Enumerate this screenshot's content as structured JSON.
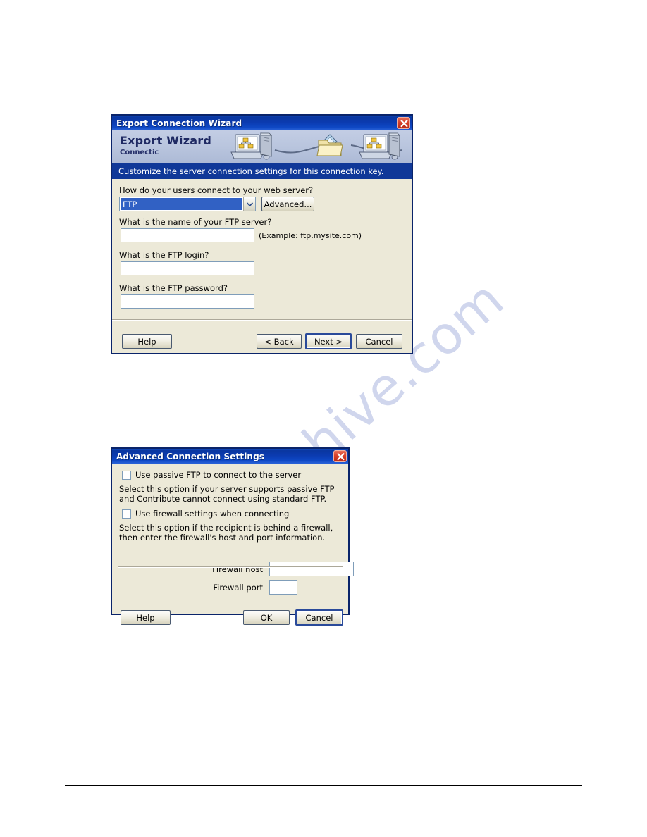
{
  "page": {
    "watermark_text": "manualshive.com"
  },
  "wizard_dialog": {
    "title": "Export Connection Wizard",
    "close_icon": "close-icon",
    "banner": {
      "title": "Export Wizard",
      "subtitle": "Connectic",
      "art": "computers-transfer-illustration"
    },
    "subtitle_bar": "Customize the server connection settings for this connection key.",
    "fields": {
      "connection_question": "How do your users connect to your web server?",
      "connection_value": "FTP",
      "advanced_button": "Advanced...",
      "server_question": "What is the name of your FTP server?",
      "server_value": "",
      "server_placeholder": "",
      "server_example": "(Example: ftp.mysite.com)",
      "login_question": "What is the FTP login?",
      "login_value": "",
      "password_question": "What is the FTP password?",
      "password_value": ""
    },
    "buttons": {
      "help": "Help",
      "back": "< Back",
      "next": "Next >",
      "cancel": "Cancel"
    }
  },
  "advanced_dialog": {
    "title": "Advanced Connection Settings",
    "close_icon": "close-icon",
    "passive_checkbox_label": "Use passive FTP to connect to the server",
    "passive_checked": false,
    "passive_description": "Select this option if your server supports passive FTP and Contribute cannot connect using standard FTP.",
    "firewall_checkbox_label": "Use firewall settings when connecting",
    "firewall_checked": false,
    "firewall_description": "Select this option if the recipient is behind a firewall, then enter the firewall's host and port information.",
    "firewall_host_label": "Firewall host",
    "firewall_host_value": "",
    "firewall_port_label": "Firewall port",
    "firewall_port_value": "",
    "buttons": {
      "help": "Help",
      "ok": "OK",
      "cancel": "Cancel"
    }
  },
  "colors": {
    "titlebar_blue": "#0a36a0",
    "subtitle_blue": "#103898",
    "dialog_face": "#ece9d8",
    "banner_blue": "#b9c5de",
    "selection_blue": "#3161c4",
    "close_red": "#d8402a",
    "watermark_blue": "#c3cbe8"
  }
}
